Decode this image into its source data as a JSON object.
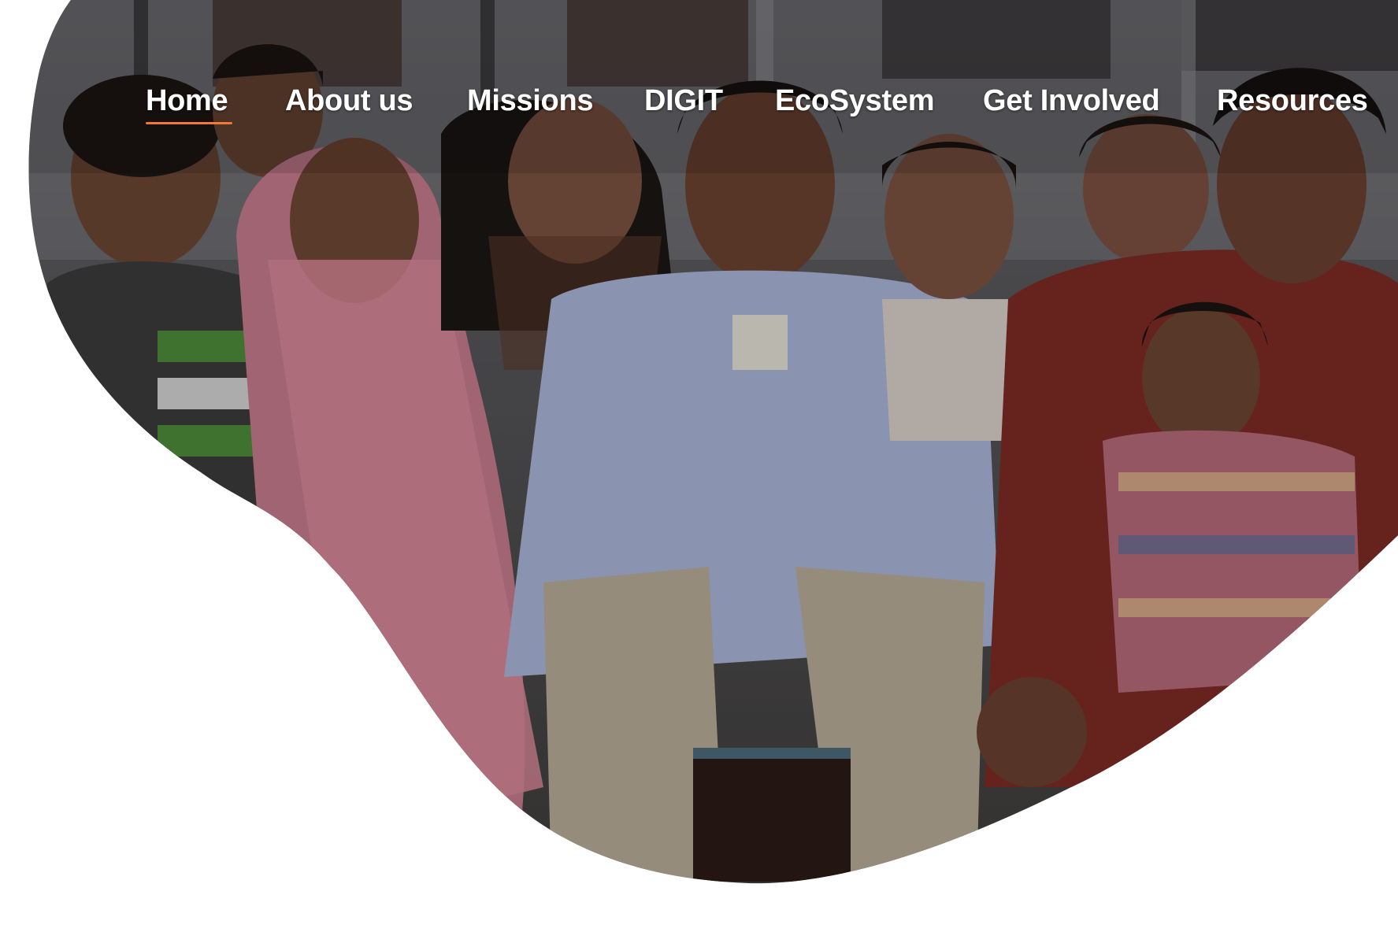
{
  "nav": {
    "items": [
      {
        "label": "Home",
        "active": true
      },
      {
        "label": "About us"
      },
      {
        "label": "Missions"
      },
      {
        "label": "DIGIT"
      },
      {
        "label": "EcoSystem"
      },
      {
        "label": "Get Involved"
      },
      {
        "label": "Resources"
      }
    ]
  },
  "colors": {
    "accent": "#f47738",
    "nav_text": "#ffffff",
    "background": "#ffffff"
  },
  "hero": {
    "image_description": "group photo of smiling people"
  }
}
